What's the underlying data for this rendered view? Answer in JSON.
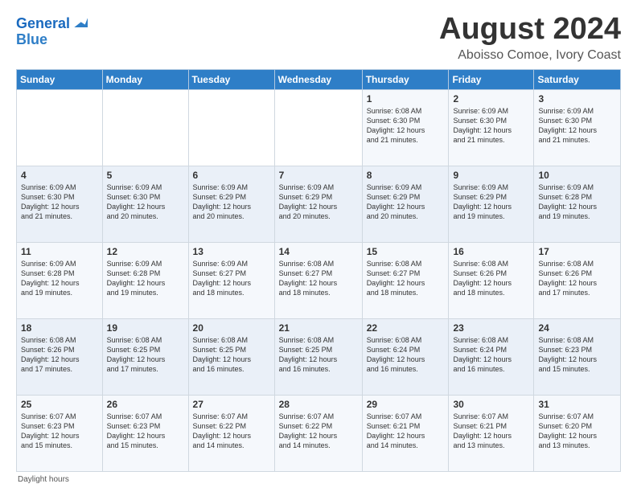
{
  "logo": {
    "line1": "General",
    "line2": "Blue"
  },
  "title": "August 2024",
  "subtitle": "Aboisso Comoe, Ivory Coast",
  "days_of_week": [
    "Sunday",
    "Monday",
    "Tuesday",
    "Wednesday",
    "Thursday",
    "Friday",
    "Saturday"
  ],
  "weeks": [
    [
      {
        "num": "",
        "info": ""
      },
      {
        "num": "",
        "info": ""
      },
      {
        "num": "",
        "info": ""
      },
      {
        "num": "",
        "info": ""
      },
      {
        "num": "1",
        "info": "Sunrise: 6:08 AM\nSunset: 6:30 PM\nDaylight: 12 hours\nand 21 minutes."
      },
      {
        "num": "2",
        "info": "Sunrise: 6:09 AM\nSunset: 6:30 PM\nDaylight: 12 hours\nand 21 minutes."
      },
      {
        "num": "3",
        "info": "Sunrise: 6:09 AM\nSunset: 6:30 PM\nDaylight: 12 hours\nand 21 minutes."
      }
    ],
    [
      {
        "num": "4",
        "info": "Sunrise: 6:09 AM\nSunset: 6:30 PM\nDaylight: 12 hours\nand 21 minutes."
      },
      {
        "num": "5",
        "info": "Sunrise: 6:09 AM\nSunset: 6:30 PM\nDaylight: 12 hours\nand 20 minutes."
      },
      {
        "num": "6",
        "info": "Sunrise: 6:09 AM\nSunset: 6:29 PM\nDaylight: 12 hours\nand 20 minutes."
      },
      {
        "num": "7",
        "info": "Sunrise: 6:09 AM\nSunset: 6:29 PM\nDaylight: 12 hours\nand 20 minutes."
      },
      {
        "num": "8",
        "info": "Sunrise: 6:09 AM\nSunset: 6:29 PM\nDaylight: 12 hours\nand 20 minutes."
      },
      {
        "num": "9",
        "info": "Sunrise: 6:09 AM\nSunset: 6:29 PM\nDaylight: 12 hours\nand 19 minutes."
      },
      {
        "num": "10",
        "info": "Sunrise: 6:09 AM\nSunset: 6:28 PM\nDaylight: 12 hours\nand 19 minutes."
      }
    ],
    [
      {
        "num": "11",
        "info": "Sunrise: 6:09 AM\nSunset: 6:28 PM\nDaylight: 12 hours\nand 19 minutes."
      },
      {
        "num": "12",
        "info": "Sunrise: 6:09 AM\nSunset: 6:28 PM\nDaylight: 12 hours\nand 19 minutes."
      },
      {
        "num": "13",
        "info": "Sunrise: 6:09 AM\nSunset: 6:27 PM\nDaylight: 12 hours\nand 18 minutes."
      },
      {
        "num": "14",
        "info": "Sunrise: 6:08 AM\nSunset: 6:27 PM\nDaylight: 12 hours\nand 18 minutes."
      },
      {
        "num": "15",
        "info": "Sunrise: 6:08 AM\nSunset: 6:27 PM\nDaylight: 12 hours\nand 18 minutes."
      },
      {
        "num": "16",
        "info": "Sunrise: 6:08 AM\nSunset: 6:26 PM\nDaylight: 12 hours\nand 18 minutes."
      },
      {
        "num": "17",
        "info": "Sunrise: 6:08 AM\nSunset: 6:26 PM\nDaylight: 12 hours\nand 17 minutes."
      }
    ],
    [
      {
        "num": "18",
        "info": "Sunrise: 6:08 AM\nSunset: 6:26 PM\nDaylight: 12 hours\nand 17 minutes."
      },
      {
        "num": "19",
        "info": "Sunrise: 6:08 AM\nSunset: 6:25 PM\nDaylight: 12 hours\nand 17 minutes."
      },
      {
        "num": "20",
        "info": "Sunrise: 6:08 AM\nSunset: 6:25 PM\nDaylight: 12 hours\nand 16 minutes."
      },
      {
        "num": "21",
        "info": "Sunrise: 6:08 AM\nSunset: 6:25 PM\nDaylight: 12 hours\nand 16 minutes."
      },
      {
        "num": "22",
        "info": "Sunrise: 6:08 AM\nSunset: 6:24 PM\nDaylight: 12 hours\nand 16 minutes."
      },
      {
        "num": "23",
        "info": "Sunrise: 6:08 AM\nSunset: 6:24 PM\nDaylight: 12 hours\nand 16 minutes."
      },
      {
        "num": "24",
        "info": "Sunrise: 6:08 AM\nSunset: 6:23 PM\nDaylight: 12 hours\nand 15 minutes."
      }
    ],
    [
      {
        "num": "25",
        "info": "Sunrise: 6:07 AM\nSunset: 6:23 PM\nDaylight: 12 hours\nand 15 minutes."
      },
      {
        "num": "26",
        "info": "Sunrise: 6:07 AM\nSunset: 6:23 PM\nDaylight: 12 hours\nand 15 minutes."
      },
      {
        "num": "27",
        "info": "Sunrise: 6:07 AM\nSunset: 6:22 PM\nDaylight: 12 hours\nand 14 minutes."
      },
      {
        "num": "28",
        "info": "Sunrise: 6:07 AM\nSunset: 6:22 PM\nDaylight: 12 hours\nand 14 minutes."
      },
      {
        "num": "29",
        "info": "Sunrise: 6:07 AM\nSunset: 6:21 PM\nDaylight: 12 hours\nand 14 minutes."
      },
      {
        "num": "30",
        "info": "Sunrise: 6:07 AM\nSunset: 6:21 PM\nDaylight: 12 hours\nand 13 minutes."
      },
      {
        "num": "31",
        "info": "Sunrise: 6:07 AM\nSunset: 6:20 PM\nDaylight: 12 hours\nand 13 minutes."
      }
    ]
  ],
  "footer": "Daylight hours"
}
